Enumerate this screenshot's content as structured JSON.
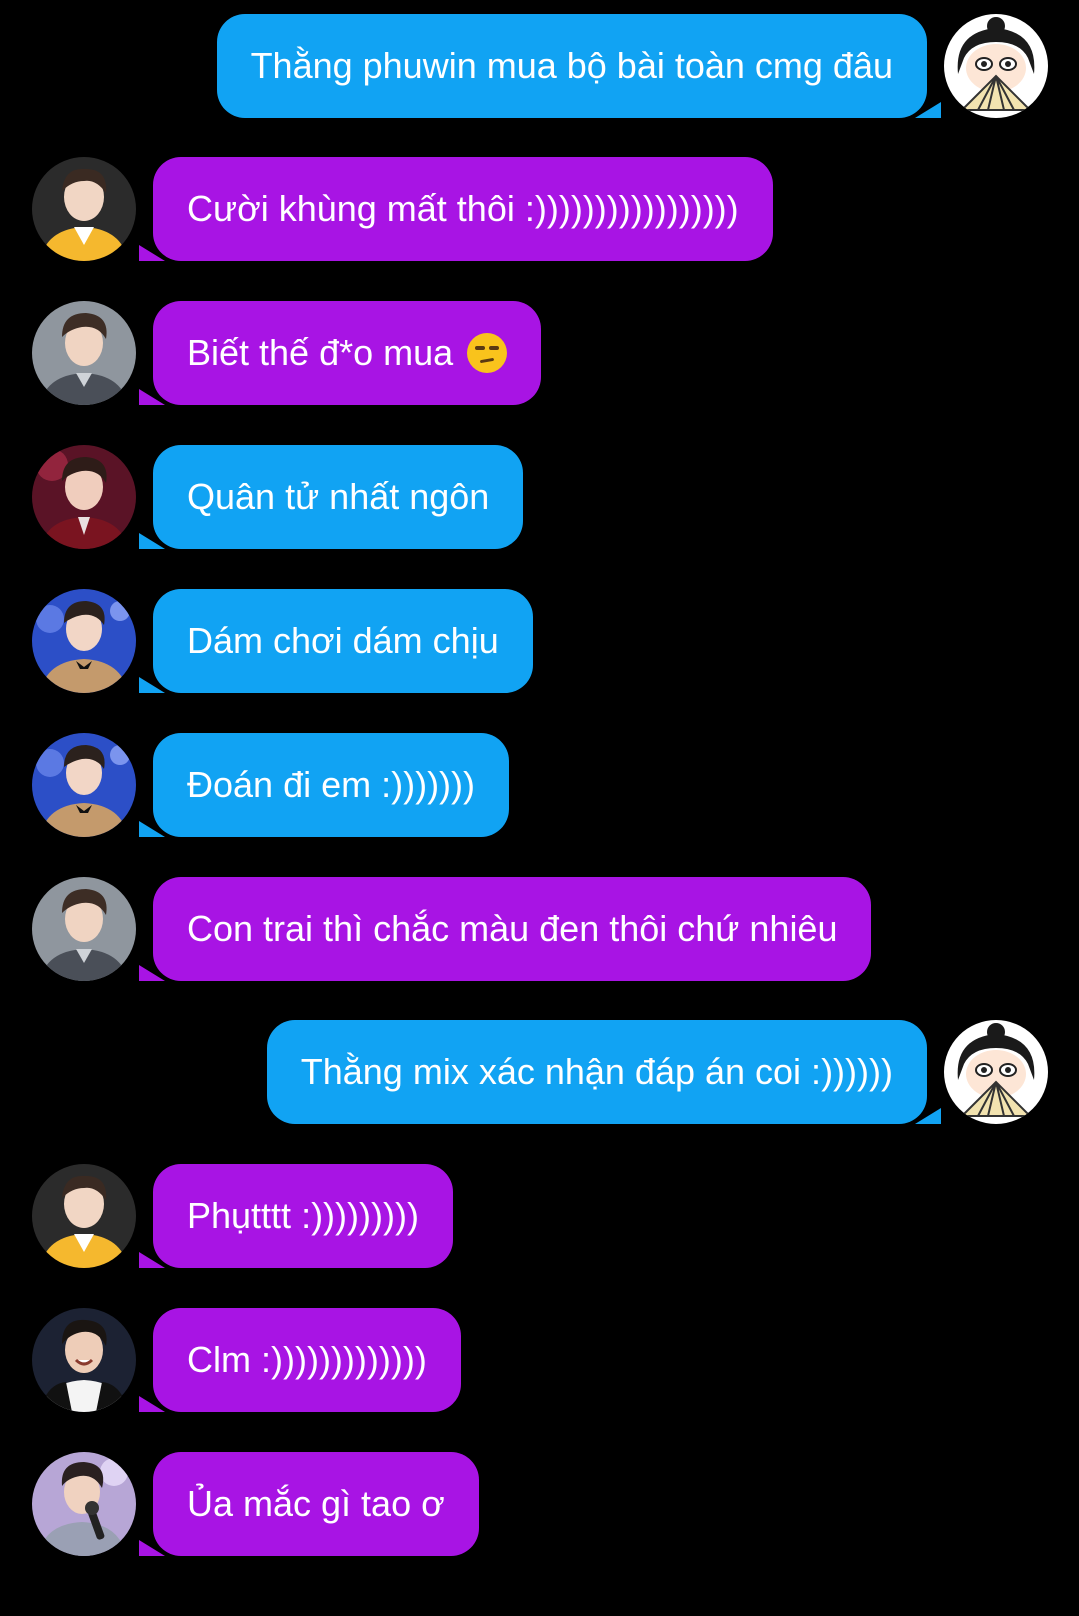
{
  "colors": {
    "background": "#000000",
    "bubble_blue": "#11a3f3",
    "bubble_purple": "#a814e4",
    "text": "#ffffff"
  },
  "messages": [
    {
      "side": "right",
      "color": "blue",
      "text": "Thằng phuwin mua bộ bài toàn cmg đâu",
      "avatar": "cartoon-girl-fan-avatar"
    },
    {
      "side": "left",
      "color": "purple",
      "text": "Cười khùng mất thôi :)))))))))))))))))",
      "avatar": "yellow-jacket-man-avatar"
    },
    {
      "side": "left",
      "color": "purple",
      "text": "Biết thế đ*o mua",
      "emoji": "unamused-face-emoji",
      "avatar": "grey-jacket-man-avatar"
    },
    {
      "side": "left",
      "color": "blue",
      "text": "Quân tử nhất ngôn",
      "avatar": "red-stage-man-avatar"
    },
    {
      "side": "left",
      "color": "blue",
      "text": "Dám chơi dám chịu",
      "avatar": "blue-stage-man-avatar"
    },
    {
      "side": "left",
      "color": "blue",
      "text": "Đoán đi em :)))))))",
      "avatar": "blue-stage-man-avatar"
    },
    {
      "side": "left",
      "color": "purple",
      "text": "Con trai thì chắc màu đen thôi chứ nhiêu",
      "avatar": "grey-jacket-man-avatar"
    },
    {
      "side": "right",
      "color": "blue",
      "text": "Thằng mix xác nhận đáp án coi :))))))",
      "avatar": "cartoon-girl-fan-avatar"
    },
    {
      "side": "left",
      "color": "purple",
      "text": "Phụtttt :)))))))))",
      "avatar": "yellow-jacket-man-avatar"
    },
    {
      "side": "left",
      "color": "purple",
      "text": "Clm :)))))))))))))",
      "avatar": "smiling-man-avatar"
    },
    {
      "side": "left",
      "color": "purple",
      "text": "Ủa mắc gì tao ơ",
      "avatar": "microphone-man-avatar"
    }
  ]
}
